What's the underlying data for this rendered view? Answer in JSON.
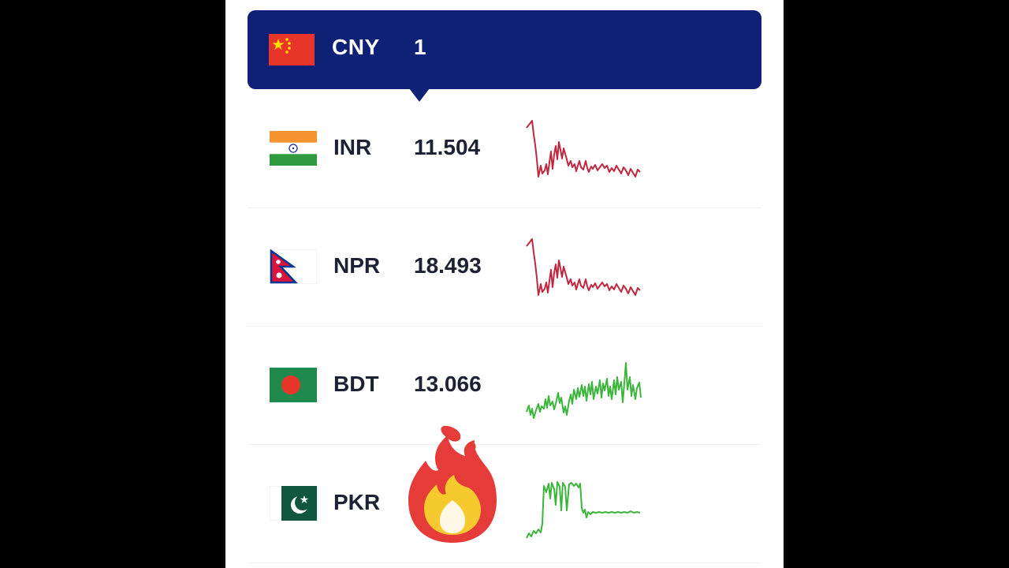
{
  "base": {
    "code": "CNY",
    "amount": "1",
    "flag_icon": "china-flag-icon"
  },
  "rows": [
    {
      "code": "INR",
      "rate": "11.504",
      "flag_icon": "india-flag-icon",
      "trend": "down",
      "trend_color": "#c0283f"
    },
    {
      "code": "NPR",
      "rate": "18.493",
      "flag_icon": "nepal-flag-icon",
      "trend": "down",
      "trend_color": "#c0283f"
    },
    {
      "code": "BDT",
      "rate": "13.066",
      "flag_icon": "bangladesh-flag-icon",
      "trend": "up",
      "trend_color": "#3bb53b"
    },
    {
      "code": "PKR",
      "rate": "",
      "flag_icon": "pakistan-flag-icon",
      "trend": "up",
      "trend_color": "#3bb53b"
    }
  ],
  "overlay": {
    "icon": "fire-emoji-icon"
  },
  "colors": {
    "base_bar": "#0f2176",
    "text": "#1c2233",
    "down": "#c0283f",
    "up": "#3bb53b"
  }
}
